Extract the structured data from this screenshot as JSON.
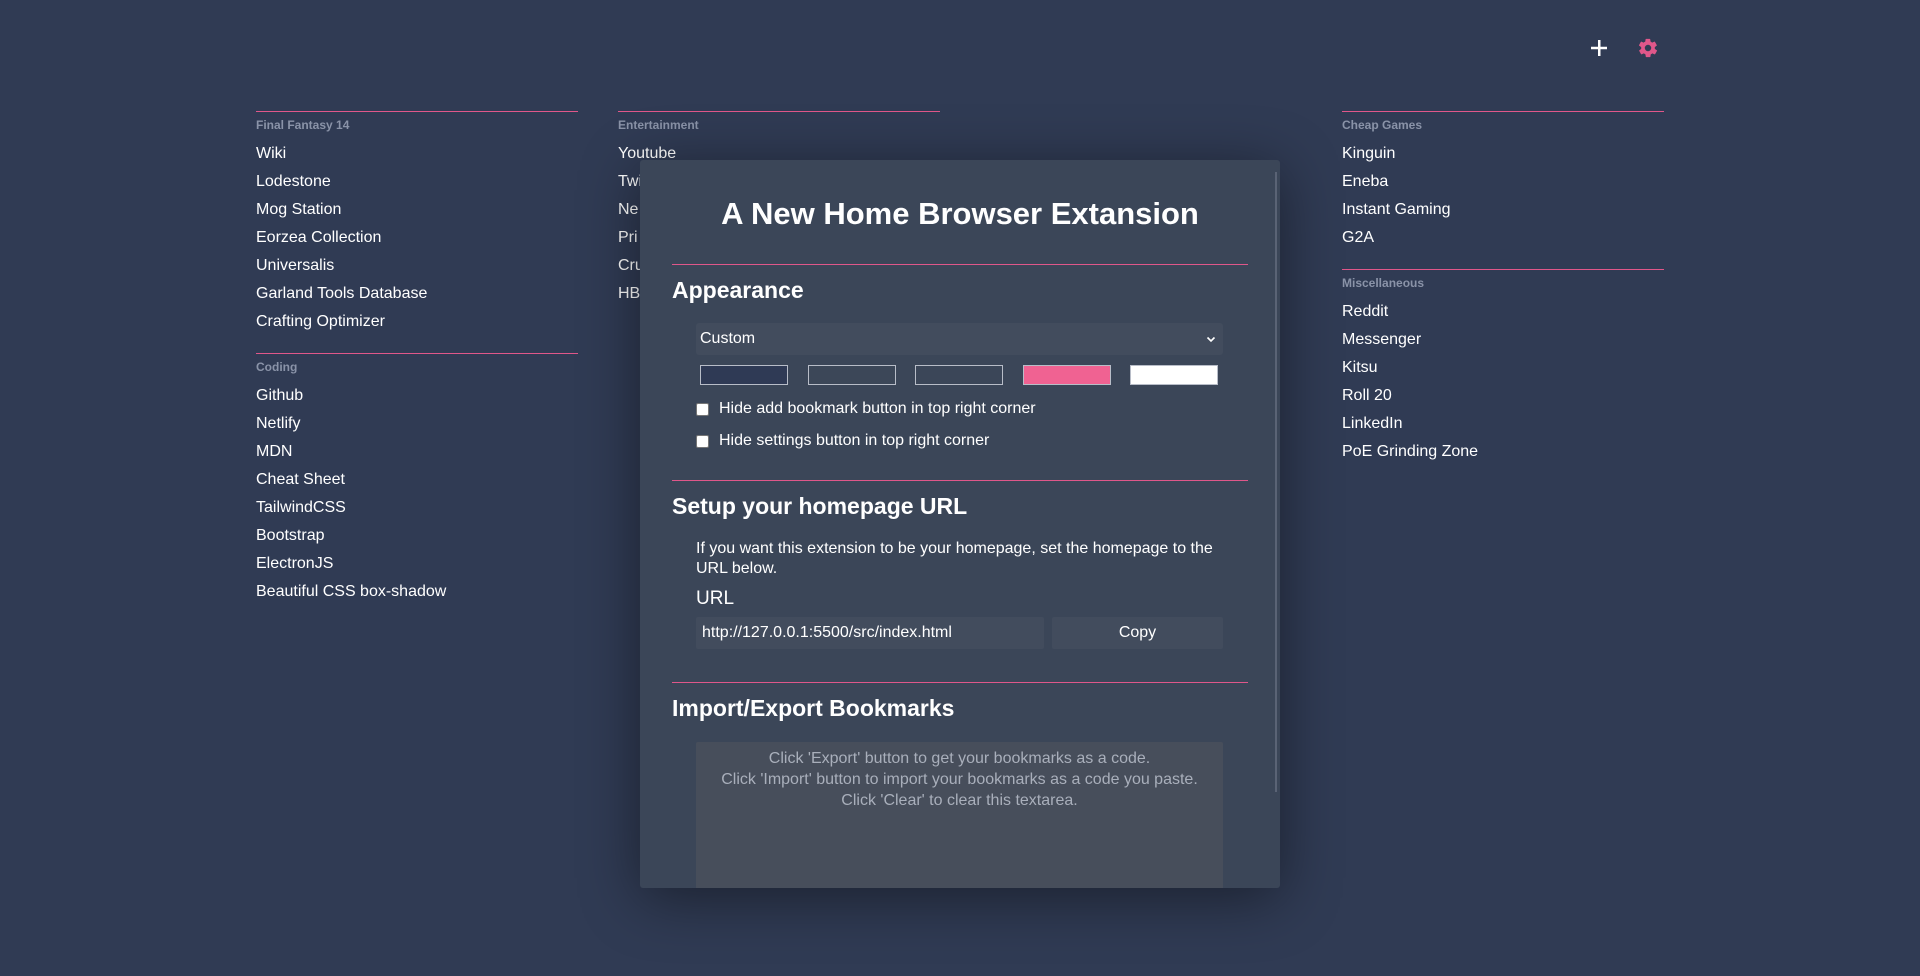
{
  "topbar": {
    "add_icon": "plus-icon",
    "settings_icon": "gear-icon",
    "add_color": "#ffffff",
    "settings_color": "#e0578a"
  },
  "columns": {
    "left": [
      {
        "title": "Final Fantasy 14",
        "links": [
          "Wiki",
          "Lodestone",
          "Mog Station",
          "Eorzea Collection",
          "Universalis",
          "Garland Tools Database",
          "Crafting Optimizer"
        ]
      },
      {
        "title": "Coding",
        "links": [
          "Github",
          "Netlify",
          "MDN",
          "Cheat Sheet",
          "TailwindCSS",
          "Bootstrap",
          "ElectronJS",
          "Beautiful CSS box-shadow"
        ]
      }
    ],
    "middle": [
      {
        "title": "Entertainment",
        "links": [
          "Youtube",
          "Twi",
          "Ne",
          "Pri",
          "Cru",
          "HB"
        ]
      }
    ],
    "right": [
      {
        "title": "Cheap Games",
        "links": [
          "Kinguin",
          "Eneba",
          "Instant Gaming",
          "G2A"
        ]
      },
      {
        "title": "Miscellaneous",
        "links": [
          "Reddit",
          "Messenger",
          "Kitsu",
          "Roll 20",
          "LinkedIn",
          "PoE Grinding Zone"
        ]
      }
    ]
  },
  "modal": {
    "title": "A New Home Browser Extansion",
    "appearance": {
      "heading": "Appearance",
      "theme_selected": "Custom",
      "swatch_colors": [
        "#2f3a55",
        "#3c4758",
        "#3b4658",
        "#f06292",
        "#ffffff"
      ],
      "hide_add_label": "Hide add bookmark button in top right corner",
      "hide_settings_label": "Hide settings button in top right corner"
    },
    "homepage": {
      "heading": "Setup your homepage URL",
      "description": "If you want this extension to be your homepage, set the homepage to the URL below.",
      "url_label": "URL",
      "url_value": "http://127.0.0.1:5500/src/index.html",
      "copy_label": "Copy"
    },
    "import_export": {
      "heading": "Import/Export Bookmarks",
      "placeholder_line1": "Click 'Export' button to get your bookmarks as a code.",
      "placeholder_line2": "Click 'Import' button to import your bookmarks as a code you paste.",
      "placeholder_line3": "Click 'Clear' to clear this textarea."
    }
  }
}
